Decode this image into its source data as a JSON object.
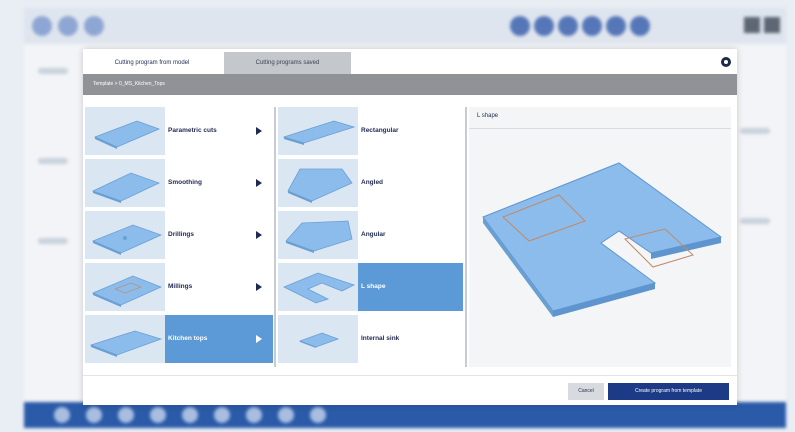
{
  "dialog": {
    "tabs": [
      {
        "label": "Cutting program from model"
      },
      {
        "label": "Cutting programs saved"
      }
    ],
    "breadcrumb": "Template > 0_MS_Kitchen_Tops",
    "categories": [
      {
        "label": "Parametric cuts",
        "selected": false
      },
      {
        "label": "Smoothing",
        "selected": false
      },
      {
        "label": "Drillings",
        "selected": false
      },
      {
        "label": "Millings",
        "selected": false
      },
      {
        "label": "Kitchen tops",
        "selected": true
      }
    ],
    "templates": [
      {
        "label": "Rectangular",
        "selected": false
      },
      {
        "label": "Angled",
        "selected": false
      },
      {
        "label": "Angular",
        "selected": false
      },
      {
        "label": "L shape",
        "selected": true
      },
      {
        "label": "Internal sink",
        "selected": false
      }
    ],
    "preview": {
      "title": "L shape"
    },
    "footer": {
      "cancel_label": "Cancel",
      "create_label": "Create program from template"
    }
  },
  "colors": {
    "selected": "#5b9ad6",
    "primary_button": "#1d3a86",
    "breadcrumb_bar": "#8f9297",
    "shape_fill": "#8cbcec"
  }
}
